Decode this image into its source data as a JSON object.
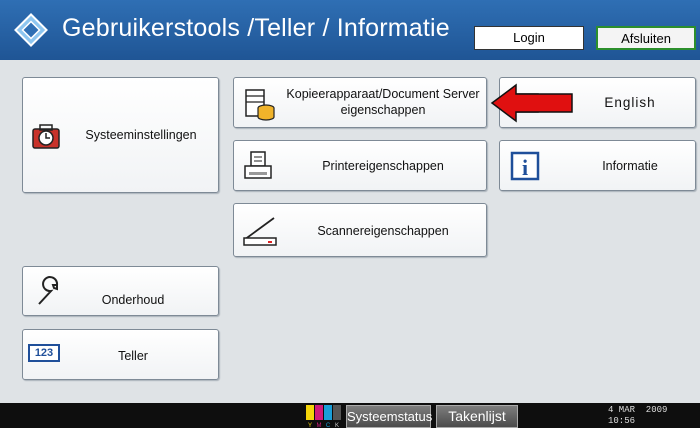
{
  "header": {
    "title": "Gebruikerstools /Teller / Informatie",
    "login_label": "Login",
    "close_label": "Afsluiten"
  },
  "buttons": {
    "system_settings": "Systeeminstellingen",
    "copier_line1": "Kopieerapparaat/Document Server",
    "copier_line2": "eigenschappen",
    "printer": "Printereigenschappen",
    "scanner": "Scannereigenschappen",
    "language": "English",
    "information": "Informatie",
    "maintenance": "Onderhoud",
    "counter": "Teller",
    "counter_icon_text": "123"
  },
  "footer": {
    "toner_letters": "YMCK",
    "system_status": "Systeemstatus",
    "job_list": "Takenlijst",
    "date": "4 MAR  2009",
    "time": "10:56"
  },
  "icons": {
    "logo": "diamond-logo-icon",
    "system_settings": "toolbox-clock-icon",
    "copier": "copier-server-icon",
    "printer": "printer-icon",
    "scanner": "scanner-icon",
    "language": "language-icon",
    "information": "info-icon",
    "maintenance": "wrench-icon",
    "counter": "counter-icon",
    "annotation": "red-arrow-icon"
  },
  "colors": {
    "header": "#2a65a8",
    "accent_green": "#2c8f2c",
    "annotation_red": "#e01010"
  }
}
